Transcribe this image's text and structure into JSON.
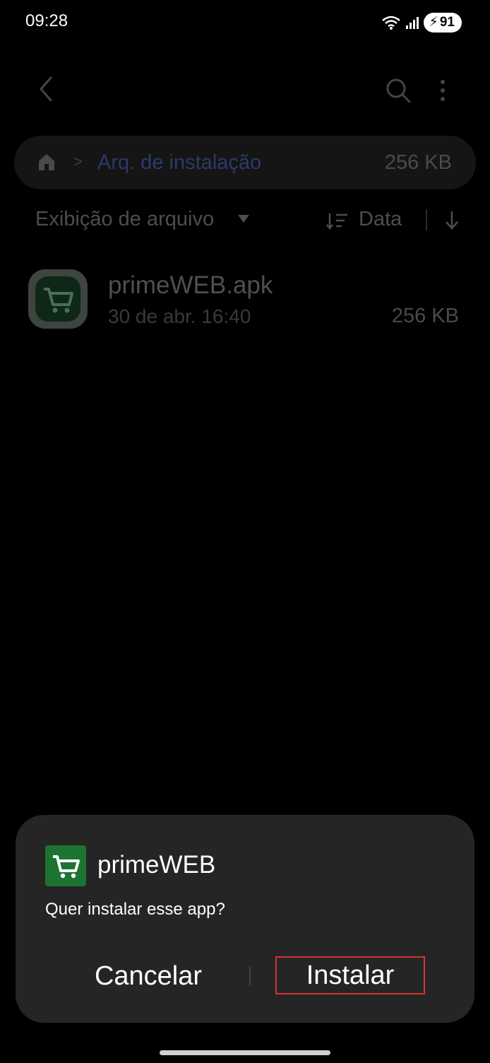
{
  "status_bar": {
    "time": "09:28",
    "battery": "91"
  },
  "breadcrumb": {
    "separator": ">",
    "folder": "Arq. de instalação",
    "size": "256 KB"
  },
  "view_bar": {
    "view_label": "Exibição de arquivo",
    "sort_label": "Data"
  },
  "file": {
    "name": "primeWEB.apk",
    "date": "30 de abr. 16:40",
    "size": "256 KB"
  },
  "dialog": {
    "app_name": "primeWEB",
    "message": "Quer instalar esse app?",
    "cancel_label": "Cancelar",
    "install_label": "Instalar"
  },
  "colors": {
    "dialog_bg": "#252525",
    "app_green": "#1c7431",
    "highlight_border": "#d9342b"
  }
}
